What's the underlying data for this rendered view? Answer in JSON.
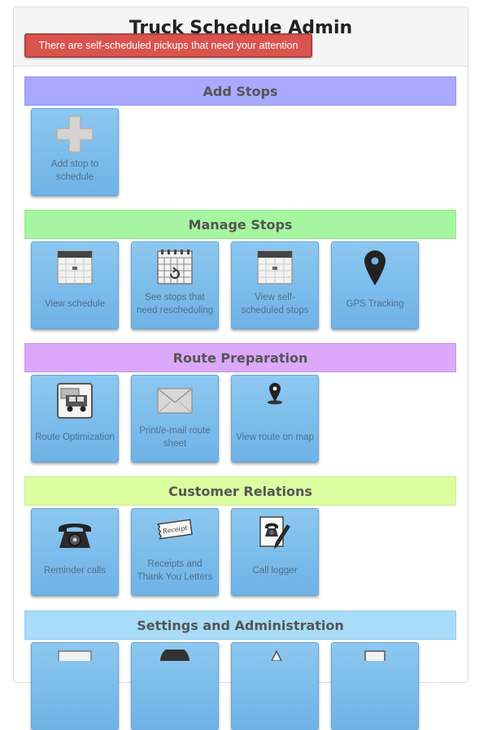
{
  "header": {
    "title": "Truck Schedule Admin",
    "alert": "There are self-scheduled pickups that need your attention"
  },
  "colors": {
    "add_stops": "#a9a9ff",
    "manage_stops": "#a6f5a0",
    "route_preparation": "#dba8fa",
    "customer_relations": "#dcfca0",
    "settings_administration": "#a8dcf8",
    "tile": "#7fbdea"
  },
  "sections": [
    {
      "title": "Add Stops",
      "tiles": [
        {
          "label": "Add stop to schedule",
          "icon": "plus-icon"
        }
      ]
    },
    {
      "title": "Manage Stops",
      "tiles": [
        {
          "label": "View schedule",
          "icon": "calendar-icon"
        },
        {
          "label": "See stops that need rescheduling",
          "icon": "calendar-reschedule-icon"
        },
        {
          "label": "View self-scheduled stops",
          "icon": "calendar-icon"
        },
        {
          "label": "GPS Tracking",
          "icon": "map-pin-icon"
        }
      ]
    },
    {
      "title": "Route Preparation",
      "tiles": [
        {
          "label": "Route Optimization",
          "icon": "trucks-icon"
        },
        {
          "label": "Print/e-mail route sheet",
          "icon": "envelope-icon"
        },
        {
          "label": "View route on map",
          "icon": "map-marker-icon"
        }
      ]
    },
    {
      "title": "Customer Relations",
      "tiles": [
        {
          "label": "Reminder calls",
          "icon": "telephone-icon"
        },
        {
          "label": "Receipts and Thank You Letters",
          "icon": "receipt-icon"
        },
        {
          "label": "Call logger",
          "icon": "call-log-icon"
        }
      ]
    },
    {
      "title": "Settings and Administration",
      "tiles": []
    }
  ]
}
